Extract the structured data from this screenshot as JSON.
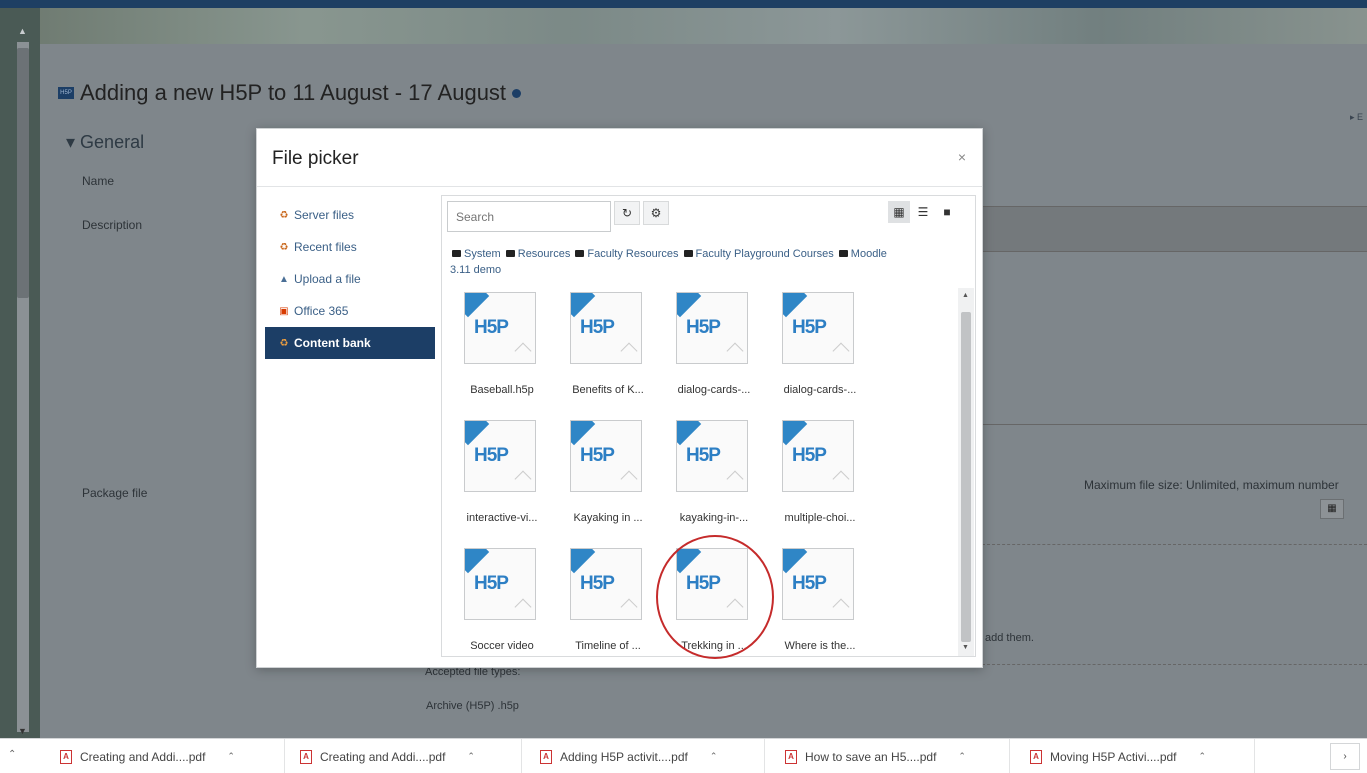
{
  "page": {
    "title": "Adding a new H5P to 11 August - 17 August",
    "section": "General",
    "labels": {
      "name": "Name",
      "description": "Description",
      "package_file": "Package file"
    },
    "expand_link": "▸ E",
    "max_file_size": "Maximum file size: Unlimited, maximum number",
    "add_them": "add them.",
    "accepted_types_label": "Accepted file types:",
    "accepted_types_value": "Archive (H5P) .h5p"
  },
  "file_picker": {
    "title": "File picker",
    "close": "×",
    "repositories": [
      {
        "label": "Server files",
        "icon": "server-icon",
        "active": false
      },
      {
        "label": "Recent files",
        "icon": "recent-icon",
        "active": false
      },
      {
        "label": "Upload a file",
        "icon": "upload-icon",
        "active": false
      },
      {
        "label": "Office 365",
        "icon": "office-icon",
        "active": false
      },
      {
        "label": "Content bank",
        "icon": "content-bank-icon",
        "active": true
      }
    ],
    "search_placeholder": "Search",
    "breadcrumb": [
      "System",
      "Resources",
      "Faculty Resources",
      "Faculty Playground Courses",
      "Moodle 3.11 demo"
    ],
    "thumbnail_text": "H5P",
    "files": [
      "Baseball.h5p",
      "Benefits of K...",
      "dialog-cards-...",
      "dialog-cards-...",
      "interactive-vi...",
      "Kayaking in ...",
      "kayaking-in-...",
      "multiple-choi...",
      "Soccer video",
      "Timeline of ...",
      "Trekking in ...",
      "Where is the..."
    ]
  },
  "downloads": [
    "Creating and Addi....pdf",
    "Creating and Addi....pdf",
    "Adding H5P activit....pdf",
    "How to save an H5....pdf",
    "Moving H5P Activi....pdf"
  ],
  "colors": {
    "accent": "#1c3e66",
    "h5p_blue": "#2d7fc4",
    "annotation_red": "#c52b2b"
  }
}
